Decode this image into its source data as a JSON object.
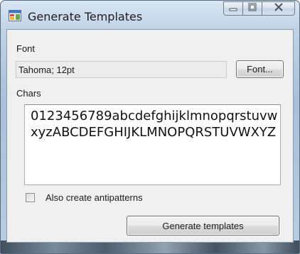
{
  "window": {
    "title": "Generate Templates"
  },
  "caption": {
    "minimize_icon": "minimize-icon",
    "maximize_icon": "maximize-icon",
    "close_icon": "close-icon"
  },
  "font_section": {
    "label": "Font",
    "current_value": "Tahoma; 12pt",
    "button_label": "Font..."
  },
  "chars_section": {
    "label": "Chars",
    "value": "0123456789abcdefghijklmnopqrstuvwxyzABCDEFGHIJKLMNOPQRSTUVWXYZ"
  },
  "options": {
    "antipatterns_label": "Also create antipatterns",
    "antipatterns_checked": false
  },
  "actions": {
    "generate_label": "Generate templates"
  },
  "colors": {
    "frame": "#b9cde2",
    "client": "#f0f0f0"
  }
}
